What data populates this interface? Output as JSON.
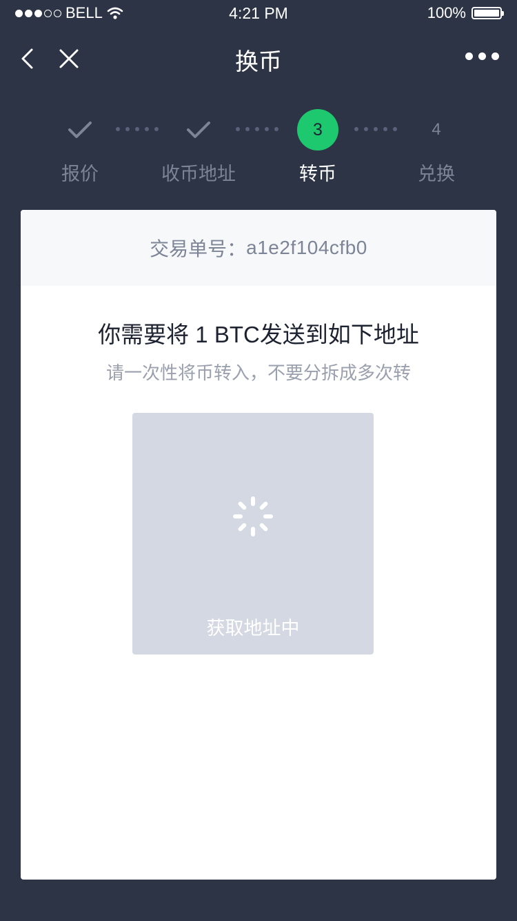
{
  "status_bar": {
    "carrier": "BELL",
    "time": "4:21 PM",
    "battery": "100%"
  },
  "nav": {
    "title": "换币",
    "back_icon": "chevron-left-icon",
    "close_icon": "close-icon",
    "more_icon": "more-dots-icon"
  },
  "steps": [
    {
      "label": "报价",
      "state": "done",
      "number": ""
    },
    {
      "label": "收币地址",
      "state": "done",
      "number": ""
    },
    {
      "label": "转币",
      "state": "active",
      "number": "3"
    },
    {
      "label": "兑换",
      "state": "pending",
      "number": "4"
    }
  ],
  "card": {
    "order_label": "交易单号：",
    "order_id": "a1e2f104cfb0",
    "send_title": "你需要将 1 BTC发送到如下地址",
    "send_subtitle": "请一次性将币转入，不要分拆成多次转",
    "address_loading_text": "获取地址中"
  },
  "colors": {
    "background": "#2c3446",
    "accent": "#1dc86e",
    "inactive": "#7c8496",
    "placeholder": "#d4d8e2"
  }
}
